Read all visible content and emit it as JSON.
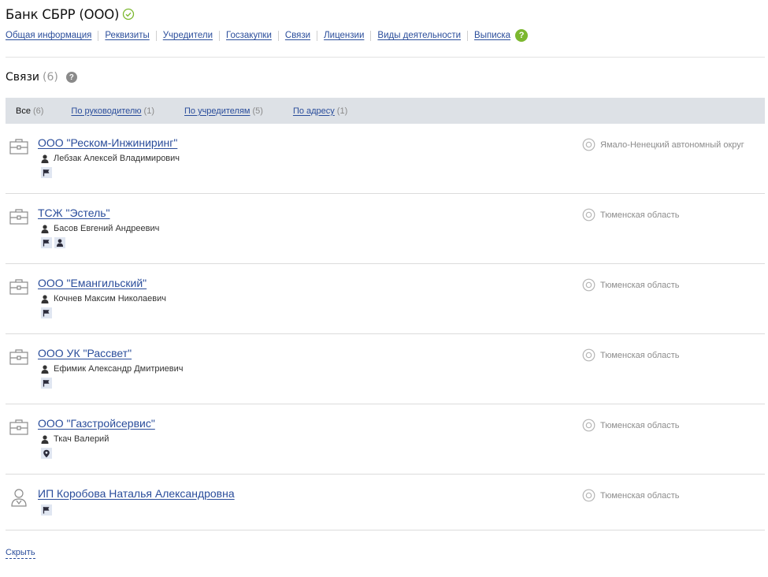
{
  "header": {
    "title": "Банк СБРР (ООО)",
    "nav": [
      {
        "label": "Общая информация"
      },
      {
        "label": "Реквизиты"
      },
      {
        "label": "Учредители"
      },
      {
        "label": "Госзакупки"
      },
      {
        "label": "Связи"
      },
      {
        "label": "Лицензии"
      },
      {
        "label": "Виды деятельности"
      },
      {
        "label": "Выписка"
      }
    ],
    "help_symbol": "?"
  },
  "section": {
    "title": "Связи",
    "count": "(6)",
    "help_symbol": "?"
  },
  "filters": [
    {
      "label": "Все",
      "count": "(6)",
      "active": true
    },
    {
      "label": "По руководителю",
      "count": "(1)",
      "active": false
    },
    {
      "label": "По учредителям",
      "count": "(5)",
      "active": false
    },
    {
      "label": "По адресу",
      "count": "(1)",
      "active": false
    }
  ],
  "connections": [
    {
      "name": "ООО \"Реском-Инжиниринг\"",
      "person": "Лебзак Алексей Владимирович",
      "region": "Ямало-Ненецкий автономный округ",
      "entity_icon": "briefcase-icon",
      "tags": [
        "flag-icon"
      ]
    },
    {
      "name": "ТСЖ \"Эстель\"",
      "person": "Басов Евгений Андреевич",
      "region": "Тюменская область",
      "entity_icon": "briefcase-icon",
      "tags": [
        "flag-icon",
        "person-icon"
      ]
    },
    {
      "name": "ООО \"Емангильский\"",
      "person": "Кочнев Максим Николаевич",
      "region": "Тюменская область",
      "entity_icon": "briefcase-icon",
      "tags": [
        "flag-icon"
      ]
    },
    {
      "name": "ООО УК \"Рассвет\"",
      "person": "Ефимик Александр Дмитриевич",
      "region": "Тюменская область",
      "entity_icon": "briefcase-icon",
      "tags": [
        "flag-icon"
      ]
    },
    {
      "name": "ООО \"Газстройсервис\"",
      "person": "Ткач Валерий",
      "region": "Тюменская область",
      "entity_icon": "briefcase-icon",
      "tags": [
        "location-pin-icon"
      ]
    },
    {
      "name": "ИП Коробова Наталья Александровна",
      "person": "",
      "region": "Тюменская область",
      "entity_icon": "entrepreneur-icon",
      "tags": [
        "flag-icon"
      ]
    }
  ],
  "footer": {
    "hide_label": "Скрыть"
  },
  "colors": {
    "link": "#2a4d9b",
    "verified": "#7cb82f",
    "filter_bar": "#dde1e6",
    "tag_bg": "#e0e6f1",
    "muted": "#8c8c8c"
  }
}
